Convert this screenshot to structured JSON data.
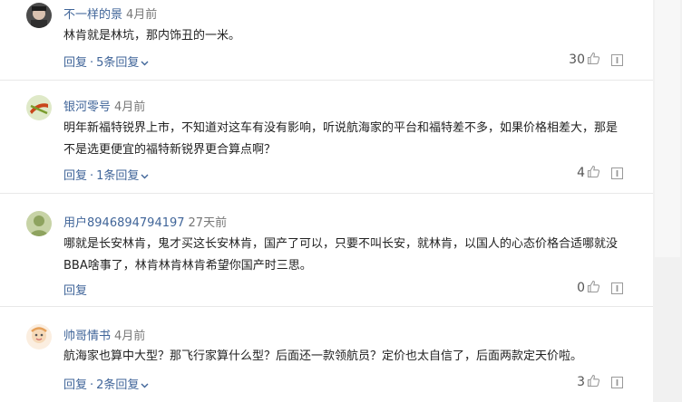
{
  "comments": [
    {
      "user": "不一样的景",
      "time": "4月前",
      "text": "林肯就是林坑，那内饰丑的一米。",
      "reply_label": "回复",
      "sep": "·",
      "replies_label": "5条回复",
      "likes": "30",
      "avatar_icon": "avatar-photo"
    },
    {
      "user": "银河零号",
      "time": "4月前",
      "text": "明年新福特锐界上市，不知道对这车有没有影响，听说航海家的平台和福特差不多，如果价格相差大，那是不是选更便宜的福特新锐界更合算点啊？",
      "reply_label": "回复",
      "sep": "·",
      "replies_label": "1条回复",
      "likes": "4",
      "avatar_icon": "avatar-logo"
    },
    {
      "user": "用户8946894794197",
      "time": "27天前",
      "text": "哪就是长安林肯，鬼才买这长安林肯，国产了可以，只要不叫长安，就林肯，以国人的心态价格合适哪就没BBA啥事了，林肯林肯林肯希望你国产时三思。",
      "reply_label": "回复",
      "likes": "0",
      "avatar_icon": "avatar-default"
    },
    {
      "user": "帅哥情书",
      "time": "4月前",
      "text": "航海家也算中大型？那飞行家算什么型？后面还一款领航员？定价也太自信了，后面两款定天价啦。",
      "reply_label": "回复",
      "sep": "·",
      "replies_label": "2条回复",
      "likes": "3",
      "avatar_icon": "avatar-cartoon"
    }
  ]
}
